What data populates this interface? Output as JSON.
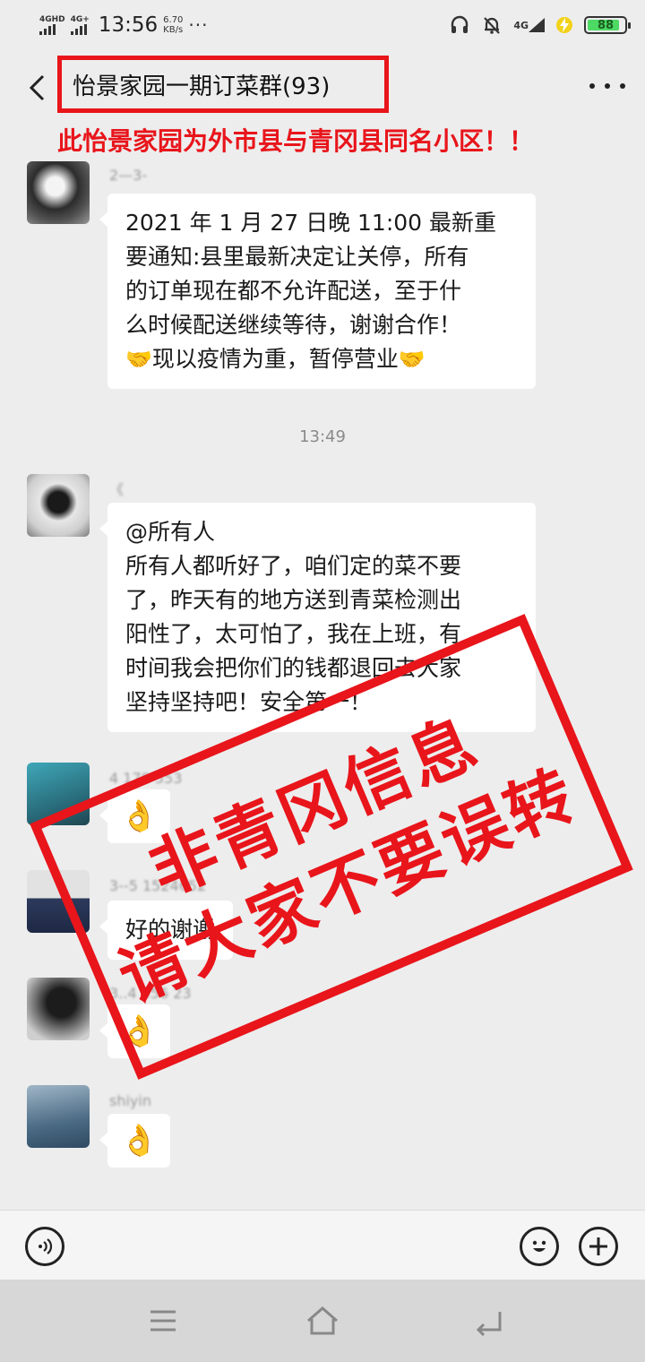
{
  "status_bar": {
    "sim1": "4GHD",
    "sim2": "4G+",
    "time": "13:56",
    "net_speed_value": "6.70",
    "net_speed_unit": "KB/s",
    "dots": "···",
    "network_right": "4G",
    "battery": "88",
    "battery_level": 0.88
  },
  "header": {
    "title": "怡景家园一期订菜群(93)",
    "more_label": "···"
  },
  "warning_banner": "此怡景家园为外市县与青冈县同名小区！！",
  "messages": [
    {
      "sender": "2—3-",
      "lines": [
        "2021 年 1 月 27 日晚 11:00 最新重",
        "要通知:县里最新决定让关停，所有",
        "的订单现在都不允许配送，至于什",
        "么时候配送继续等待，谢谢合作！",
        "现以疫情为重，暂停营业"
      ]
    },
    {
      "time_separator": "13:49"
    },
    {
      "sender": "《",
      "lines": [
        "@所有人",
        "所有人都听好了，咱们定的菜不要",
        "了，昨天有的地方送到青菜检测出",
        "阳性了，太可怕了，我在上班，有",
        "时间我会把你们的钱都退回去大家",
        "坚持坚持吧！安全第一！"
      ]
    },
    {
      "sender": "4          178 553",
      "emoji": "👌"
    },
    {
      "sender": "3--5     1524652",
      "text": "好的谢谢"
    },
    {
      "sender": "3..4    356      23",
      "emoji": "👌"
    },
    {
      "sender": "shiyin",
      "emoji": "👌"
    }
  ],
  "handshake_emoji": "🤝",
  "stamp": {
    "line1": "非青冈信息",
    "line2": "请大家不要误转"
  },
  "colors": {
    "stamp_red": "#e8151b",
    "background": "#ededed",
    "bubble": "#ffffff",
    "battery_green": "#4cd964"
  }
}
